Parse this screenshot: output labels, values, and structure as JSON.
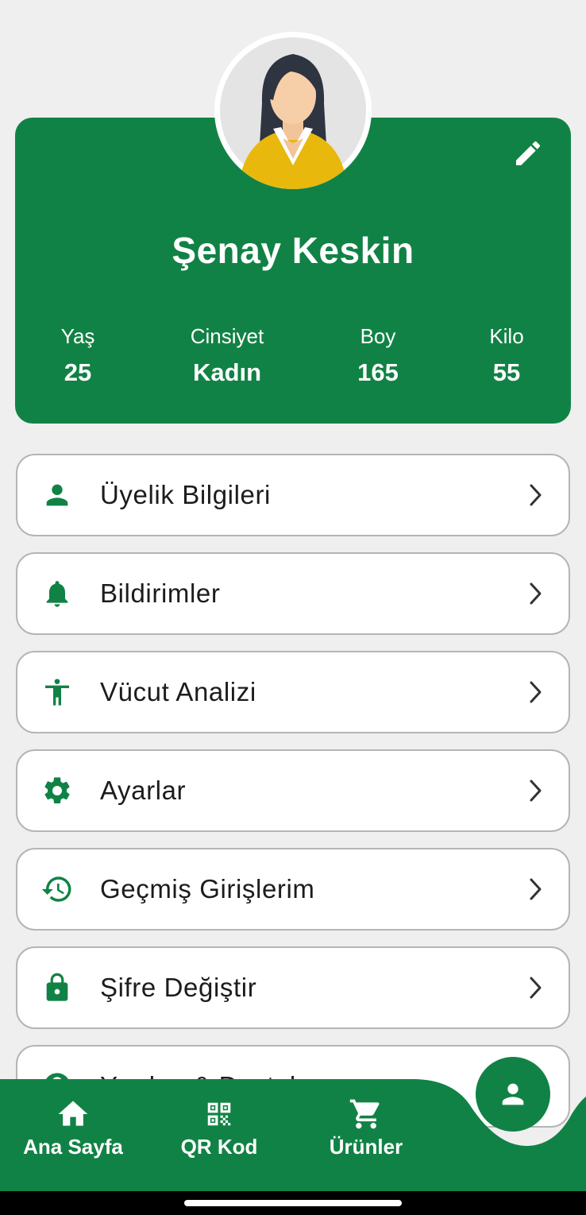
{
  "profile": {
    "name": "Şenay Keskin",
    "stats": [
      {
        "label": "Yaş",
        "value": "25"
      },
      {
        "label": "Cinsiyet",
        "value": "Kadın"
      },
      {
        "label": "Boy",
        "value": "165"
      },
      {
        "label": "Kilo",
        "value": "55"
      }
    ],
    "edit_icon": "pencil-icon",
    "avatar": "female-avatar"
  },
  "menu": [
    {
      "label": "Üyelik Bilgileri",
      "icon": "person-icon"
    },
    {
      "label": "Bildirimler",
      "icon": "bell-icon"
    },
    {
      "label": "Vücut Analizi",
      "icon": "accessibility-icon"
    },
    {
      "label": "Ayarlar",
      "icon": "gear-icon"
    },
    {
      "label": "Geçmiş Girişlerim",
      "icon": "history-icon"
    },
    {
      "label": "Şifre Değiştir",
      "icon": "lock-icon"
    },
    {
      "label": "Yardım & Destek",
      "icon": "help-icon"
    }
  ],
  "bottom_nav": {
    "items": [
      {
        "label": "Ana Sayfa",
        "icon": "home-icon"
      },
      {
        "label": "QR Kod",
        "icon": "qr-code-icon"
      },
      {
        "label": "Ürünler",
        "icon": "cart-icon"
      }
    ],
    "active_icon": "person-icon"
  },
  "colors": {
    "brand_green": "#118245",
    "background": "#efefef",
    "card_border": "#b5b5b5",
    "avatar_shirt": "#e8b90c"
  }
}
